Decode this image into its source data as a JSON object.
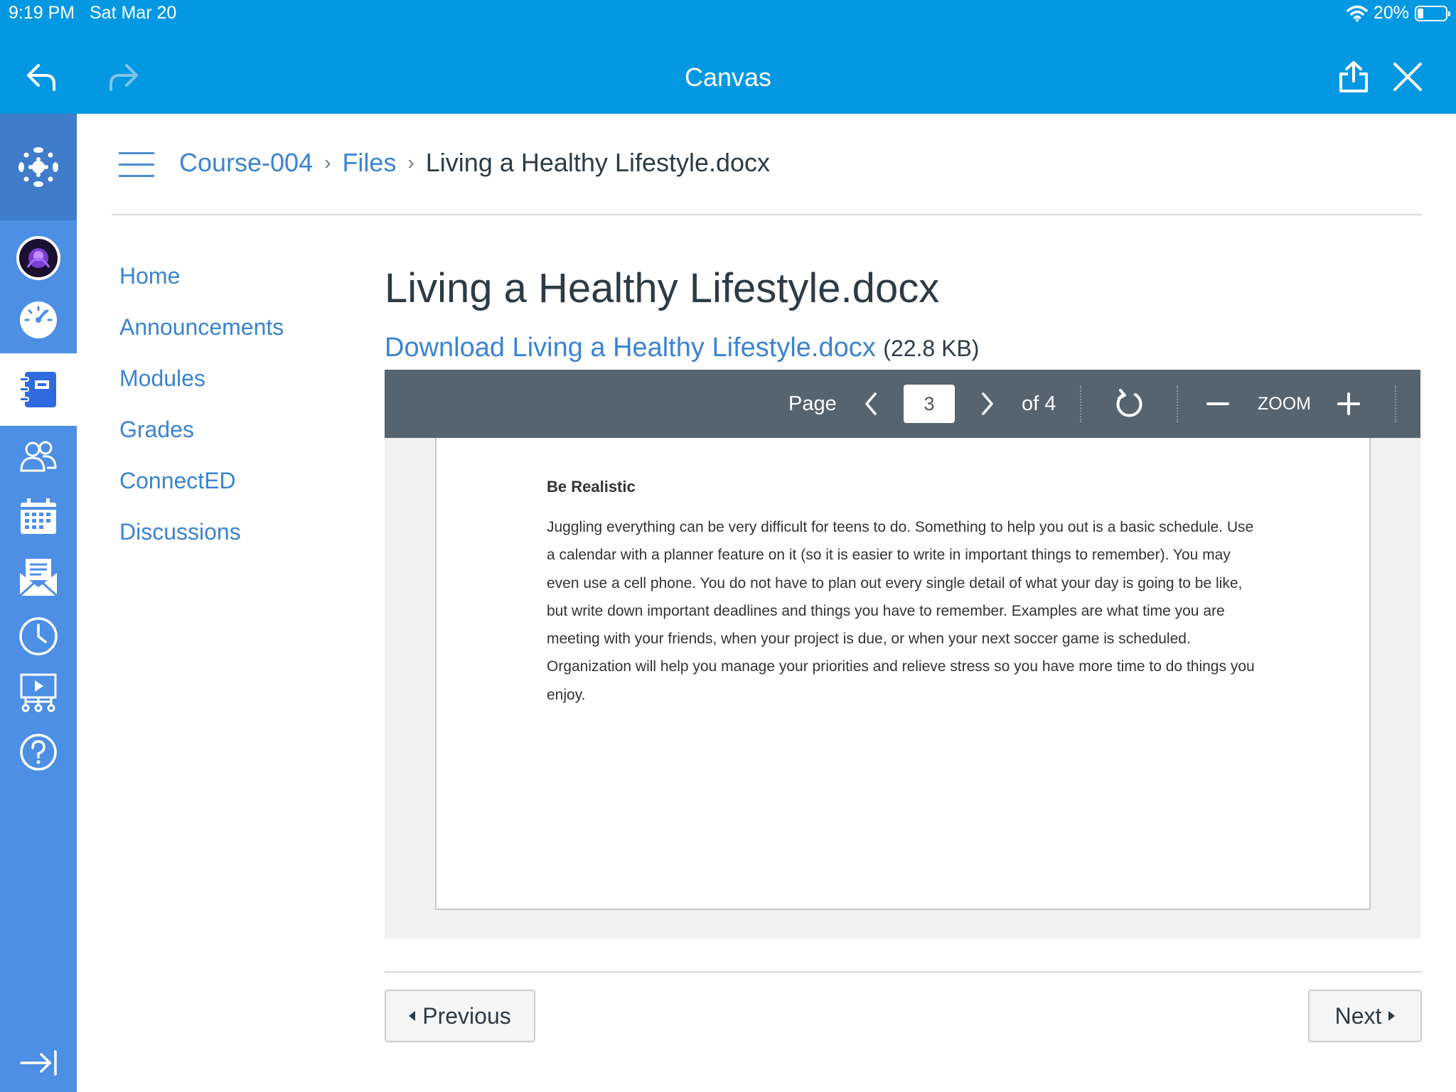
{
  "status_bar": {
    "time": "9:19 PM",
    "date": "Sat Mar 20",
    "battery": "20%",
    "battery_level": 0.2
  },
  "browser": {
    "title": "Canvas",
    "icons": [
      "back-arrow-icon",
      "forward-arrow-icon",
      "share-icon",
      "close-icon"
    ]
  },
  "global_nav": {
    "icons": [
      "canvas-logo-icon",
      "account-avatar-icon",
      "dashboard-icon",
      "courses-icon",
      "groups-icon",
      "calendar-icon",
      "inbox-icon",
      "history-icon",
      "commons-icon",
      "help-icon",
      "collapse-nav-icon"
    ],
    "active": "courses-icon"
  },
  "breadcrumb": {
    "course": "Course-004",
    "section": "Files",
    "current": "Living a Healthy Lifestyle.docx"
  },
  "course_nav": {
    "items": [
      "Home",
      "Announcements",
      "Modules",
      "Grades",
      "ConnectED",
      "Discussions"
    ]
  },
  "file": {
    "title": "Living a Healthy Lifestyle.docx",
    "download_label": "Download Living a Healthy Lifestyle.docx",
    "size": "(22.8 KB)"
  },
  "viewer": {
    "page_label": "Page",
    "page_current": "3",
    "page_total": "of 4",
    "zoom_label": "ZOOM"
  },
  "document": {
    "heading": "Be Realistic",
    "body": "Juggling everything can be very difficult for teens to do. Something to help you out is a basic schedule. Use a calendar with a planner feature on it (so it is easier to write in important things to remember). You may even use a cell phone. You do not have to plan out every single detail of what your day is going to be like, but write down important deadlines and things you have to remember. Examples are what time you are meeting with your friends, when your project is due, or when your next soccer game is scheduled. Organization will help you manage your priorities and relieve stress so you have more time to do things you enjoy."
  },
  "pager": {
    "previous": "Previous",
    "next": "Next"
  },
  "colors": {
    "brand_blue": "#0398e1",
    "nav_blue": "#4c8fe5",
    "link_blue": "#3b84d1",
    "toolbar_gray": "#566470"
  }
}
